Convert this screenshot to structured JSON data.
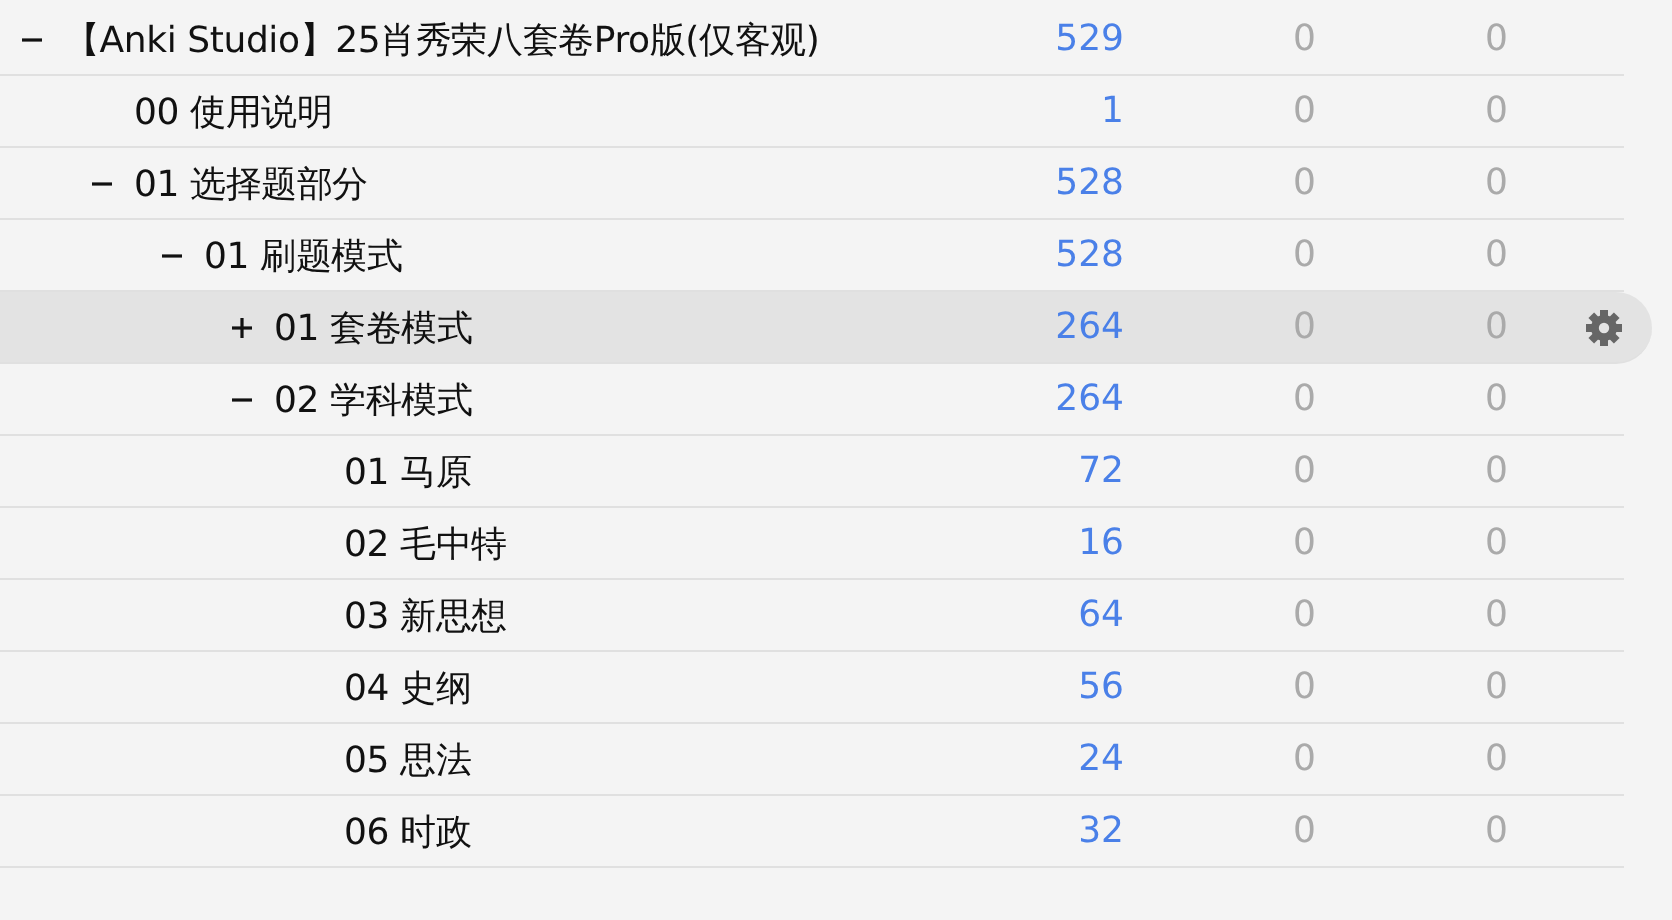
{
  "decks": [
    {
      "name": "【Anki Studio】25肖秀荣八套卷Pro版(仅客观)",
      "column_2": "529",
      "column_3": "0",
      "column_4": "0",
      "expanded": true,
      "selected": false,
      "children": [
        {
          "name": "00 使用说明",
          "column_2": "1",
          "column_3": "0",
          "column_4": "0",
          "selected": false
        },
        {
          "name": "01 选择题部分",
          "column_2": "528",
          "column_3": "0",
          "column_4": "0",
          "expanded": true,
          "selected": false,
          "children": [
            {
              "name": "01 刷题模式",
              "column_2": "528",
              "column_3": "0",
              "column_4": "0",
              "expanded": true,
              "selected": false,
              "children": [
                {
                  "name": "01 套卷模式",
                  "column_2": "264",
                  "column_3": "0",
                  "column_4": "0",
                  "expanded": false,
                  "selected": true
                },
                {
                  "name": "02 学科模式",
                  "column_2": "264",
                  "column_3": "0",
                  "column_4": "0",
                  "expanded": true,
                  "selected": false,
                  "children": [
                    {
                      "name": "01 马原",
                      "column_2": "72",
                      "column_3": "0",
                      "column_4": "0",
                      "selected": false
                    },
                    {
                      "name": "02 毛中特",
                      "column_2": "16",
                      "column_3": "0",
                      "column_4": "0",
                      "selected": false
                    },
                    {
                      "name": "03 新思想",
                      "column_2": "64",
                      "column_3": "0",
                      "column_4": "0",
                      "selected": false
                    },
                    {
                      "name": "04 史纲",
                      "column_2": "56",
                      "column_3": "0",
                      "column_4": "0",
                      "selected": false
                    },
                    {
                      "name": "05 思法",
                      "column_2": "24",
                      "column_3": "0",
                      "column_4": "0",
                      "selected": false
                    },
                    {
                      "name": "06 时政",
                      "column_2": "32",
                      "column_3": "0",
                      "column_4": "0",
                      "selected": false
                    }
                  ]
                }
              ]
            }
          ]
        }
      ]
    }
  ]
}
